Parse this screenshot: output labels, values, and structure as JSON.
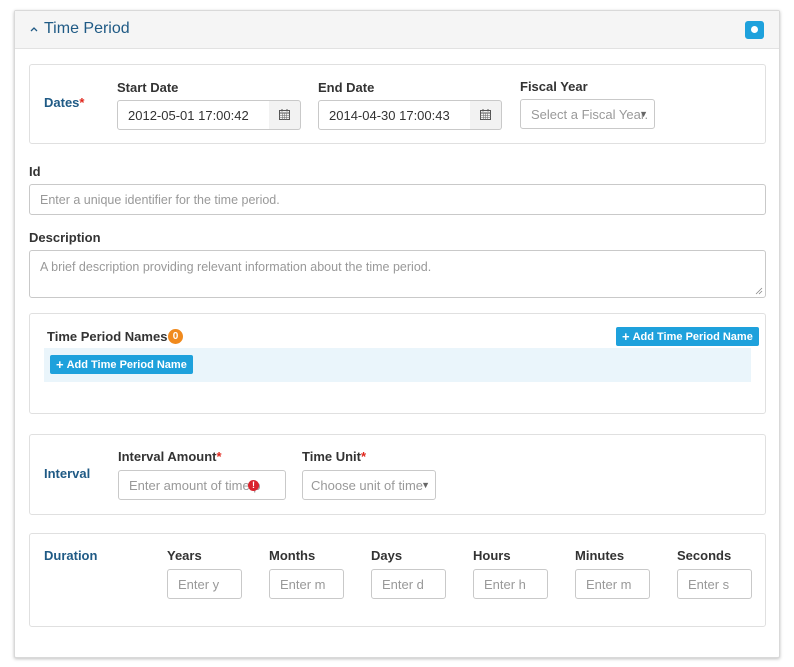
{
  "panel": {
    "title": "Time Period"
  },
  "dates": {
    "label": "Dates",
    "required_mark": "*",
    "start_date": {
      "label": "Start Date",
      "value": "2012-05-01 17:00:42"
    },
    "end_date": {
      "label": "End Date",
      "value": "2014-04-30 17:00:43"
    },
    "fiscal_year": {
      "label": "Fiscal Year",
      "placeholder": "Select a Fiscal Year."
    }
  },
  "id_field": {
    "label": "Id",
    "placeholder": "Enter a unique identifier for the time period."
  },
  "description": {
    "label": "Description",
    "placeholder": "A brief description providing relevant information about the time period."
  },
  "names": {
    "label": "Time Period Names",
    "count": "0",
    "add_label_top": "Add Time Period Name",
    "add_label_inline": "Add Time Period Name"
  },
  "interval": {
    "label": "Interval",
    "amount": {
      "label": "Interval Amount",
      "placeholder": "Enter amount of time p",
      "error_mark": "!"
    },
    "unit": {
      "label": "Time Unit",
      "placeholder": "Choose unit of time"
    }
  },
  "duration": {
    "label": "Duration",
    "fields": [
      {
        "label": "Years",
        "placeholder": "Enter y"
      },
      {
        "label": "Months",
        "placeholder": "Enter m"
      },
      {
        "label": "Days",
        "placeholder": "Enter d"
      },
      {
        "label": "Hours",
        "placeholder": "Enter h"
      },
      {
        "label": "Minutes",
        "placeholder": "Enter m"
      },
      {
        "label": "Seconds",
        "placeholder": "Enter s"
      }
    ]
  },
  "icons": {
    "collapse": "caret-up-icon",
    "calendar": "calendar-icon",
    "plus": "plus-icon",
    "dropdown": "caret-down-icon"
  },
  "colors": {
    "accent": "#1ea1dc",
    "title": "#1f5a85",
    "required": "#e0261c",
    "badge": "#f08a1e"
  }
}
